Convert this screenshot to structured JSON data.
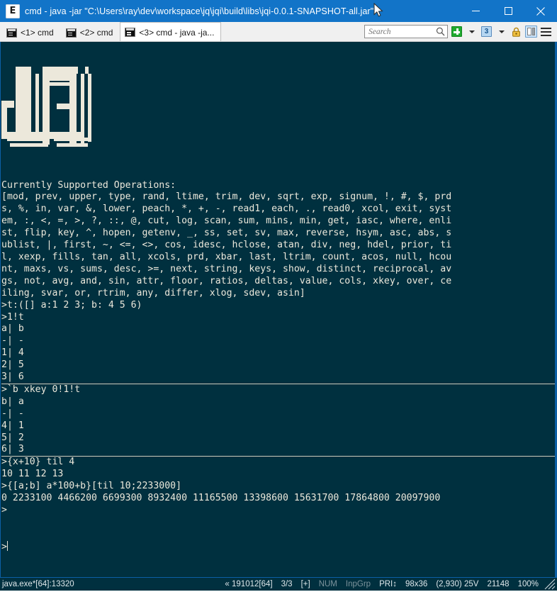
{
  "window": {
    "icon_glyph": "E",
    "title": "cmd - java  -jar \"C:\\Users\\ray\\dev\\workspace\\jq\\jqi\\build\\libs\\jqi-0.0.1-SNAPSHOT-all.jar\"",
    "minimize_label": "Minimize",
    "maximize_label": "Maximize",
    "close_label": "Close"
  },
  "tabbar": {
    "tabs": [
      {
        "label": "<1> cmd",
        "active": false
      },
      {
        "label": "<2> cmd",
        "active": false
      },
      {
        "label": "<3> cmd - java  -ja...",
        "active": true
      }
    ],
    "search": {
      "placeholder": "Search",
      "value": ""
    },
    "new_console_label": "New console",
    "new_console_dropdown_label": "New console options",
    "active_console_count": "3",
    "console_list_dropdown_label": "Console list",
    "lock_label": "Lock",
    "panels_label": "Toggle panels",
    "menu_label": "Main menu"
  },
  "terminal": {
    "logo_lines": [
      "  ██  ██████ ",
      "  ██ ██    ██",
      "  ██ ██    ██",
      "  ██ ██    ██",
      "███   ██████ ",
      "            █"
    ],
    "lines": [
      {
        "text": "Currently Supported Operations:",
        "rule": false
      },
      {
        "text": "[mod, prev, upper, type, rand, ltime, trim, dev, sqrt, exp, signum, !, #, $, prd",
        "rule": false
      },
      {
        "text": "s, %, in, var, &, lower, peach, *, +, -, read1, each, ., read0, xcol, exit, syst",
        "rule": false
      },
      {
        "text": "em, :, <, =, >, ?, ::, @, cut, log, scan, sum, mins, min, get, iasc, where, enli",
        "rule": false
      },
      {
        "text": "st, flip, key, ^, hopen, getenv, _, ss, set, sv, max, reverse, hsym, asc, abs, s",
        "rule": false
      },
      {
        "text": "ublist, |, first, ~, <=, <>, cos, idesc, hclose, atan, div, neg, hdel, prior, ti",
        "rule": false
      },
      {
        "text": "l, xexp, fills, tan, all, xcols, prd, xbar, last, ltrim, count, acos, null, hcou",
        "rule": false
      },
      {
        "text": "nt, maxs, vs, sums, desc, >=, next, string, keys, show, distinct, reciprocal, av",
        "rule": false
      },
      {
        "text": "gs, not, avg, and, sin, attr, floor, ratios, deltas, value, cols, xkey, over, ce",
        "rule": false
      },
      {
        "text": "iling, svar, or, rtrim, any, differ, xlog, sdev, asin]",
        "rule": false
      },
      {
        "text": ">t:([] a:1 2 3; b: 4 5 6)",
        "rule": false
      },
      {
        "text": ">1!t",
        "rule": false
      },
      {
        "text": "a| b",
        "rule": false
      },
      {
        "text": "-| -",
        "rule": false
      },
      {
        "text": "1| 4",
        "rule": false
      },
      {
        "text": "2| 5",
        "rule": false
      },
      {
        "text": "3| 6",
        "rule": true
      },
      {
        "text": ">`b xkey 0!1!t",
        "rule": false
      },
      {
        "text": "b| a",
        "rule": false
      },
      {
        "text": "-| -",
        "rule": false
      },
      {
        "text": "4| 1",
        "rule": false
      },
      {
        "text": "5| 2",
        "rule": false
      },
      {
        "text": "6| 3",
        "rule": true
      },
      {
        "text": ">{x+10} til 4",
        "rule": false
      },
      {
        "text": "10 11 12 13",
        "rule": false
      },
      {
        "text": ">{[a;b] a*100+b}[til 10;2233000]",
        "rule": false
      },
      {
        "text": "0 2233100 4466200 6699300 8932400 11165500 13398600 15631700 17864800 20097900",
        "rule": false
      },
      {
        "text": ">",
        "rule": false
      }
    ],
    "prompt": ">"
  },
  "statusbar": {
    "process": "java.exe*[64]:13320",
    "memory": "« 191012[64]",
    "tab_index": "3/3",
    "expand": "[+]",
    "num_lock": "NUM",
    "input_group": "InpGrp",
    "priority": "PRI↕",
    "size": "98x36",
    "cursor": "(2,930) 25V",
    "buffer": "21148",
    "zoom": "100%"
  },
  "colors": {
    "titlebar": "#1274c8",
    "frame": "#0b5fa5",
    "terminal_bg": "#00303f",
    "terminal_fg": "#ece8db",
    "statusbar_bg": "#00303f",
    "accent_green": "#1faa2f"
  }
}
